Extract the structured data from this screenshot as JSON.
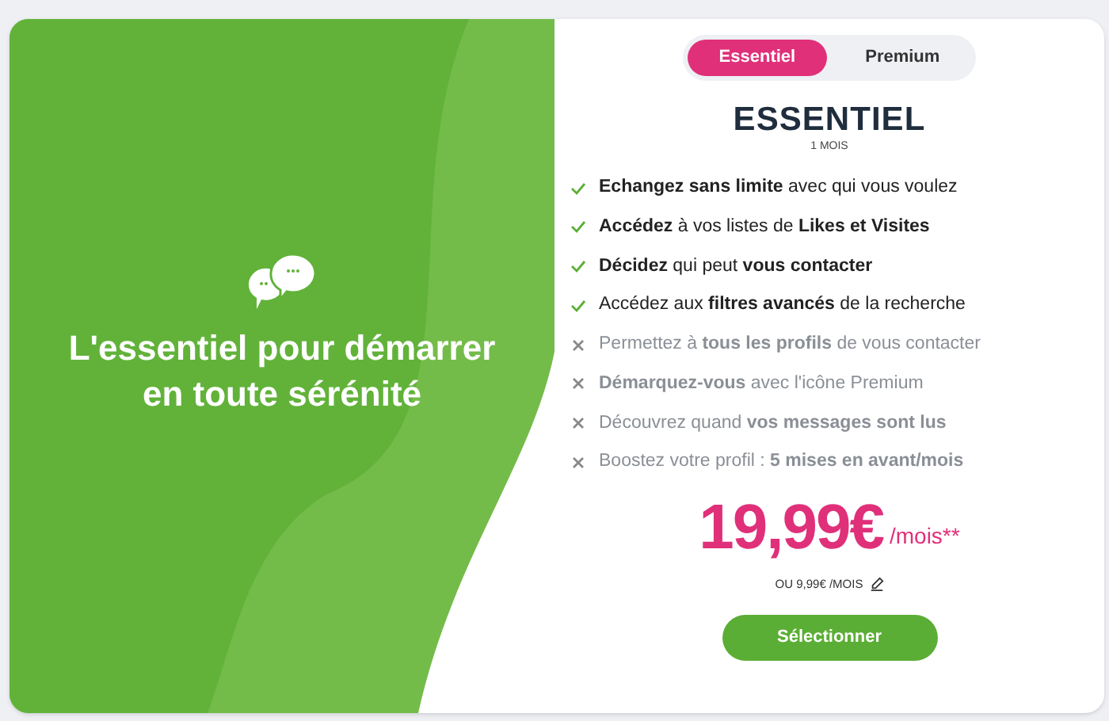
{
  "hero": {
    "title": "L'essentiel pour démarrer en toute sérénité"
  },
  "tabs": [
    {
      "label": "Essentiel",
      "selected": true
    },
    {
      "label": "Premium",
      "selected": false
    }
  ],
  "plan": {
    "name": "ESSENTIEL",
    "duration": "1 MOIS"
  },
  "features": [
    {
      "text": "**Echangez sans limite** avec qui vous voulez",
      "included": true
    },
    {
      "text": "**Accédez** à vos listes de **Likes et Visites**",
      "included": true
    },
    {
      "text": "**Décidez** qui peut **vous contacter**",
      "included": true
    },
    {
      "text": "Accédez aux **filtres avancés** de la recherche",
      "included": true
    },
    {
      "text": "Permettez à **tous les profils** de vous contacter",
      "included": false
    },
    {
      "text": "**Démarquez-vous** avec l'icône Premium",
      "included": false
    },
    {
      "text": "Découvrez quand **vos messages sont lus**",
      "included": false
    },
    {
      "text": "Boostez votre profil : **5 mises en avant/mois**",
      "included": false
    }
  ],
  "price": {
    "amount": "19,99€",
    "unit": "/mois**",
    "alternative": "OU 9,99€ /MOIS"
  },
  "select_button": "Sélectionner"
}
